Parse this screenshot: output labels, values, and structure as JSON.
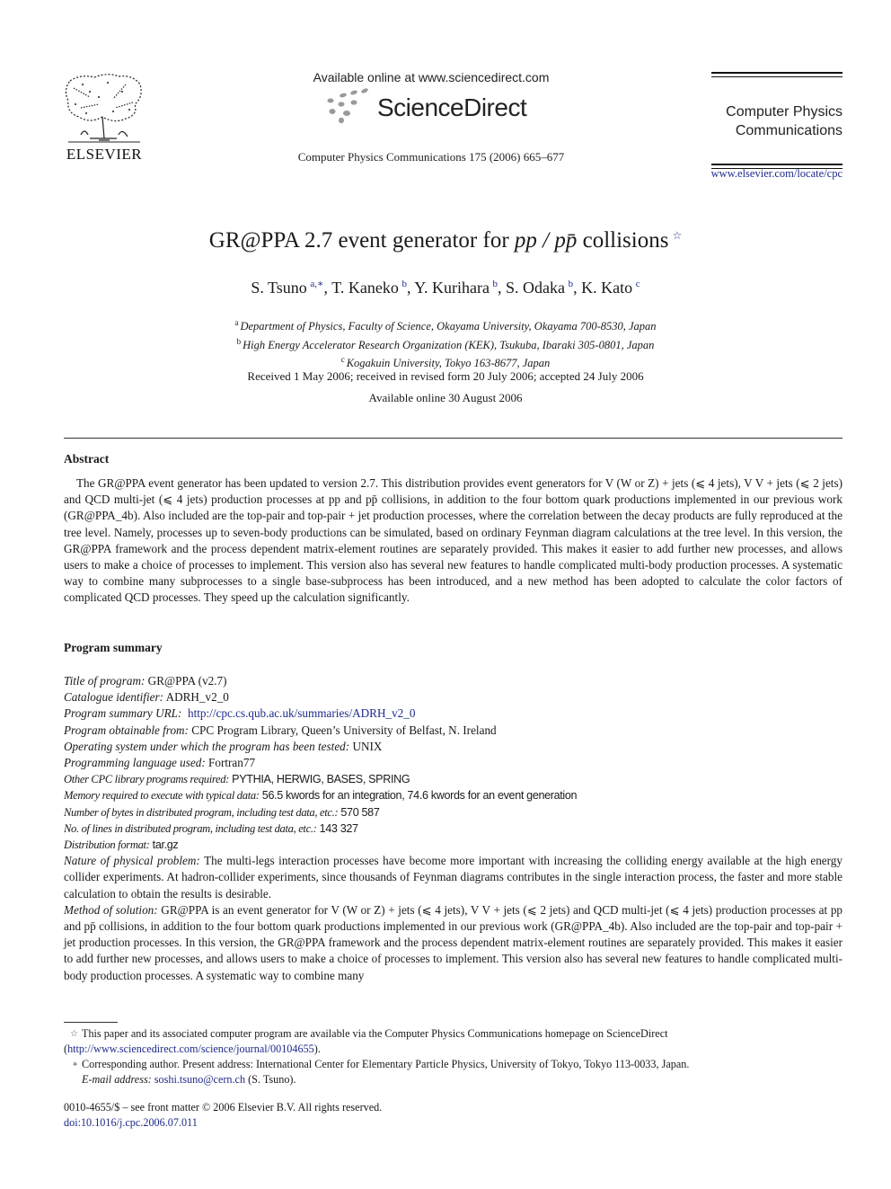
{
  "header": {
    "publisher_logo_text": "ELSEVIER",
    "available_online": "Available online at www.sciencedirect.com",
    "sciencedirect_logo_text": "ScienceDirect",
    "journal_reference": "Computer Physics Communications 175 (2006) 665–677",
    "journal_name_line1": "Computer Physics",
    "journal_name_line2": "Communications",
    "journal_url": "www.elsevier.com/locate/cpc"
  },
  "article": {
    "title_prefix": "GR@PPA 2.7 event generator for ",
    "title_math": "pp / pp̄",
    "title_suffix": " collisions",
    "title_footnote_mark": "☆",
    "authors": [
      {
        "name": "S. Tsuno",
        "aff": "a,∗"
      },
      {
        "name": "T. Kaneko",
        "aff": "b"
      },
      {
        "name": "Y. Kurihara",
        "aff": "b"
      },
      {
        "name": "S. Odaka",
        "aff": "b"
      },
      {
        "name": "K. Kato",
        "aff": "c"
      }
    ],
    "affiliations": [
      {
        "mark": "a",
        "text": "Department of Physics, Faculty of Science, Okayama University, Okayama 700-8530, Japan"
      },
      {
        "mark": "b",
        "text": "High Energy Accelerator Research Organization (KEK), Tsukuba, Ibaraki 305-0801, Japan"
      },
      {
        "mark": "c",
        "text": "Kogakuin University, Tokyo 163-8677, Japan"
      }
    ],
    "received": "Received 1 May 2006; received in revised form 20 July 2006; accepted 24 July 2006",
    "available_online_date": "Available online 30 August 2006"
  },
  "abstract": {
    "heading": "Abstract",
    "text": "The GR@PPA event generator has been updated to version 2.7. This distribution provides event generators for V (W or Z) + jets (⩽ 4 jets), V V + jets (⩽ 2 jets) and QCD multi-jet (⩽ 4 jets) production processes at pp and pp̄ collisions, in addition to the four bottom quark productions implemented in our previous work (GR@PPA_4b). Also included are the top-pair and top-pair + jet production processes, where the correlation between the decay products are fully reproduced at the tree level. Namely, processes up to seven-body productions can be simulated, based on ordinary Feynman diagram calculations at the tree level. In this version, the GR@PPA framework and the process dependent matrix-element routines are separately provided. This makes it easier to add further new processes, and allows users to make a choice of processes to implement. This version also has several new features to handle complicated multi-body production processes. A systematic way to combine many subprocesses to a single base-subprocess has been introduced, and a new method has been adopted to calculate the color factors of complicated QCD processes. They speed up the calculation significantly."
  },
  "program_summary": {
    "heading": "Program summary",
    "items": [
      {
        "label": "Title of program:",
        "value": "GR@PPA (v2.7)",
        "link": false
      },
      {
        "label": "Catalogue identifier:",
        "value": "ADRH_v2_0",
        "link": false
      },
      {
        "label": "Program summary URL:",
        "value": "http://cpc.cs.qub.ac.uk/summaries/ADRH_v2_0",
        "link": true
      },
      {
        "label": "Program obtainable from:",
        "value": "CPC Program Library, Queen’s University of Belfast, N. Ireland",
        "link": false
      },
      {
        "label": "Operating system under which the program has been tested:",
        "value": "UNIX",
        "link": false
      },
      {
        "label": "Programming language used:",
        "value": "Fortran77",
        "link": false
      },
      {
        "label": "Other CPC library programs required:",
        "value": "PYTHIA, HERWIG, BASES, SPRING",
        "link": false,
        "condensed": true
      },
      {
        "label": "Memory required to execute with typical data:",
        "value": "56.5 kwords for an integration, 74.6 kwords for an event generation",
        "link": false,
        "condensed": true
      },
      {
        "label": "Number of bytes in distributed program, including test data, etc.:",
        "value": "570 587",
        "link": false,
        "condensed": true
      },
      {
        "label": "No. of lines in distributed program, including test data, etc.:",
        "value": "143 327",
        "link": false,
        "condensed": true
      },
      {
        "label": "Distribution format:",
        "value": "tar.gz",
        "link": false,
        "condensed": true
      },
      {
        "label": "Nature of physical problem:",
        "value": "The multi-legs interaction processes have become more important with increasing the colliding energy available at the high energy collider experiments. At hadron-collider experiments, since thousands of Feynman diagrams contributes in the single interaction process, the faster and more stable calculation to obtain the results is desirable.",
        "link": false
      },
      {
        "label": "Method of solution:",
        "value": "GR@PPA is an event generator for V (W or Z) + jets (⩽ 4 jets), V V + jets (⩽ 2 jets) and QCD multi-jet (⩽ 4 jets) production processes at pp and pp̄ collisions, in addition to the four bottom quark productions implemented in our previous work (GR@PPA_4b). Also included are the top-pair and top-pair + jet production processes. In this version, the GR@PPA framework and the process dependent matrix-element routines are separately provided. This makes it easier to add further new processes, and allows users to make a choice of processes to implement. This version also has several new features to handle complicated multi-body production processes. A systematic way to combine many",
        "link": false
      }
    ]
  },
  "footnotes": {
    "star_mark": "☆",
    "star_text": "This paper and its associated computer program are available via the Computer Physics Communications homepage on ScienceDirect (",
    "star_link": "http://www.sciencedirect.com/science/journal/00104655",
    "star_close": ").",
    "corr_mark": "∗",
    "corr_text": "Corresponding author. Present address: International Center for Elementary Particle Physics, University of Tokyo, Tokyo 113-0033, Japan.",
    "email_label": "E-mail address:",
    "email": "soshi.tsuno@cern.ch",
    "email_suffix": " (S. Tsuno)."
  },
  "copyright": {
    "line": "0010-4655/$ – see front matter  © 2006 Elsevier B.V. All rights reserved.",
    "doi": "doi:10.1016/j.cpc.2006.07.011"
  }
}
